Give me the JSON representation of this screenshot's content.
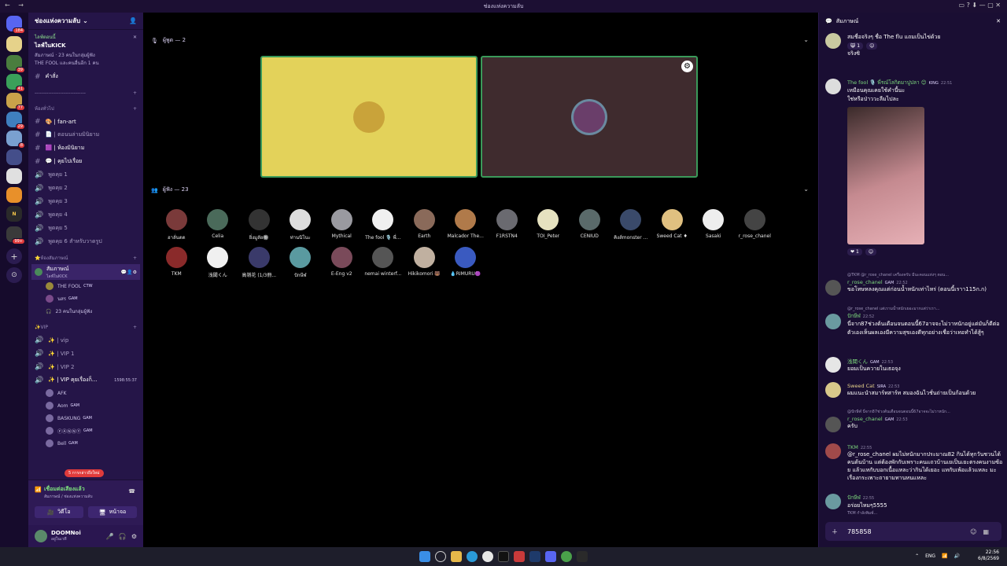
{
  "window": {
    "title": "ช่องแห่งความลับ"
  },
  "server": {
    "name": "ช่องแห่งความลับ"
  },
  "event": {
    "label": "ไลฟ์ตอนนี้",
    "title": "ไลฟ์ในKICK",
    "line1": "สัมภาษณ์ · 23 คนในกลุ่มผู้ฟัง",
    "line2": "THE FOOL และคนอื่นอีก 1 คน"
  },
  "channels_top": [
    {
      "name": "คำสั่ง"
    }
  ],
  "divider": "------------------------------",
  "cat_general": "ห้องทั่วไป",
  "general_channels": [
    {
      "name": "🎨 | fan-art"
    },
    {
      "name": "📄 | ตอนนล่ามมินิยาม"
    },
    {
      "name": "🟪 | ห้องมินิยาม"
    },
    {
      "name": "💬 | คุยไปเรื่อย"
    },
    {
      "name": "พูดคุย 1"
    },
    {
      "name": "พูดคุย 2"
    },
    {
      "name": "พูดคุย 3"
    },
    {
      "name": "พูดคุย 4"
    },
    {
      "name": "พูดคุย 5"
    },
    {
      "name": "พูดคุย 6 สำหรับวาดรูป"
    }
  ],
  "cat_interview": "⭐ห้องสัมภาษณ์",
  "stage": {
    "name": "สัมภาษณ์",
    "sub": "ไลฟ์ในKICK"
  },
  "stage_users": [
    {
      "name": "THE FOOL",
      "tag": "CTW"
    },
    {
      "name": "นสร",
      "tag": "GAM"
    }
  ],
  "stage_listen": "23 คนในกลุ่มผู้ฟัง",
  "cat_vip": "✨VIP",
  "vip_channels": [
    {
      "name": "✨ | vip"
    },
    {
      "name": "✨ | VIP 1"
    },
    {
      "name": "✨ | VIP 2"
    },
    {
      "name": "✨ | VIP คุยเรื่องก็...",
      "timer": "1598:55:37"
    }
  ],
  "vip_users": [
    {
      "name": "AFK",
      "tag": ""
    },
    {
      "name": "Aom",
      "tag": "GAM"
    },
    {
      "name": "BASKUNG",
      "tag": "GAM"
    },
    {
      "name": "ⒻⒶⓃⓃⓎ",
      "tag": "GAM"
    },
    {
      "name": "Bell",
      "tag": "GAM"
    }
  ],
  "unread_pill": "5 การกล่าวถึงใหม่",
  "voice": {
    "status": "เชื่อมต่อเสียงแล้ว",
    "where": "สัมภาษณ์ / ช่องแห่งความลับ",
    "video": "วิดีโอ",
    "screen": "หน้าจอ"
  },
  "user": {
    "name": "DOOMNoi",
    "status": "อยู่ในเวที"
  },
  "speakers": {
    "label": "ผู้พูด — 2"
  },
  "audience": {
    "label": "ผู้ฟัง — 23"
  },
  "listeners": [
    "ฮาลั่นดด",
    "Celia",
    "ยิ่งมูลัย🔘",
    "ท่านนิโนะ",
    "Mythical",
    "The fool 🎙️ พี่...",
    "Earth",
    "Malcador The...",
    "F1RSTN4",
    "TOI_Peter",
    "CENIUD",
    "คิงส์monster ...",
    "Sweed Cat ♦",
    "Sasaki",
    "r_rose_chanel",
    "TKM",
    "浅聞くん",
    "高嶺花 (1/3冊...",
    "ปักษีฬ",
    "E-Eng v2",
    "nemai winterf...",
    "Hikikomori 🐻",
    "💧RIMURU🟣"
  ],
  "chat": {
    "title": "สัมภาษณ์",
    "top_msg": "สมชื่อจริงๆ ชื่อ The flu แถมเป็นไข่ด้วย",
    "top_react": "1",
    "top_msg2": "จริงซิ",
    "msg1": {
      "name": "The fool 🎙️ พี่รณ์โลกิตมาปูปลา 😊",
      "tag": "KING",
      "time": "22:51",
      "l1": "เหมือนคุณเคยใช้คำนี้นะ",
      "l2": "ใช่หรือป่าววะลืมไปละ"
    },
    "msg1_react": "1",
    "m2_reply": "@TKM @r_rose_chanel เครื่องครับ มีนะคอนแห่งๆ ตอน...",
    "m2": {
      "name": "r_rose_chanel",
      "tag": "GAM",
      "time": "22:52",
      "text": "ขอโทษหลงคุณแต่ก่อนน้ำหนักเท่าไหร่ (ตอนนี้เราา115ก.ก)"
    },
    "m3_reply": "@r_rose_chanel แต่เรามน้ำหนักเยอะมากแต่ว่าเรา...",
    "m3": {
      "name": "ปักษีฬ",
      "time": "22:52",
      "text": "นี่จาก87ช่วงต้นเดือนจนตอนนี้67อาจจะไม่วาหนักอยู่แต่มันก็ดีต่อตัวเองเห็นผลเองมีความสุขเองดีทุกอย่างเชื่อว่าเทอทำได้สู้ๆ"
    },
    "m4": {
      "name": "浅聞くん",
      "tag": "GAM",
      "time": "22:53",
      "text": "ยอมเป็นควายในเธอจุง"
    },
    "m5": {
      "name": "Sweed Cat",
      "tag": "SIRA",
      "time": "22:53",
      "text": "ผมแนะนำสมาร์ทสาร์ท สมองฉันไวชั่นถ่ายเป็นก้อนด้วย"
    },
    "m6_reply": "@ปักษีฬ นี่จาก87ช่วงต้นเดือนจนตอนนี้67อาจจะไม่วาหนัก...",
    "m6": {
      "name": "r_rose_chanel",
      "tag": "GAM",
      "time": "22:53",
      "text": "ครับ"
    },
    "m7": {
      "name": "TKM",
      "time": "22:55",
      "text": "@r_rose_chanel ผมไม่หนักมากประมาณ82 กินได้ทุกวันชวนได้คนต้นบ้าน แต่ต้องพักกับเพราะคนแถวบ้านเยเป็นเยะตรงคนงามซ้อย แล้วแทกับบอกเนื้อแหละว่ากินได้เยอะ แทกับเพ้อแล้วแหละ มะเรื่องกระเพาะถายามทานหนแหละ"
    },
    "m8": {
      "name": "ปักษีฬ",
      "time": "22:55",
      "text": "อร่อยไหมๆ5555"
    },
    "typing": "TKM กำลังพิมพ์...",
    "input": "785858"
  },
  "server_badges": [
    "184",
    "39",
    "41",
    "77",
    "29",
    "8",
    "99+"
  ],
  "tray": {
    "lang": "ENG",
    "time": "22:56",
    "date": "6/8/2569"
  }
}
